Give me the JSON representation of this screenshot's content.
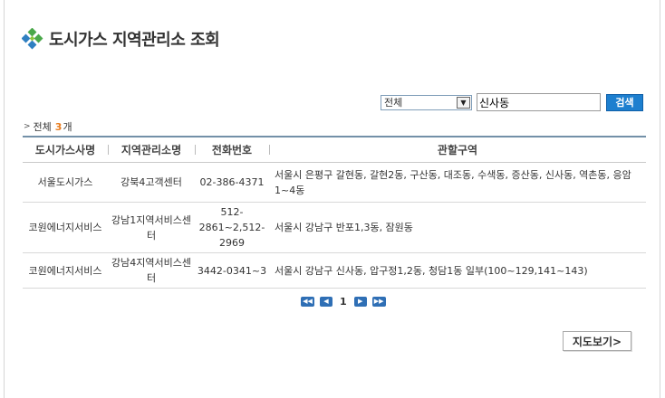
{
  "header": {
    "title": "도시가스 지역관리소 조회",
    "icon": "green-diamond-cluster-icon",
    "accent_color": "#3a9c3a"
  },
  "search": {
    "filter_selected": "전체",
    "keyword_value": "신사동",
    "search_label": "검색"
  },
  "summary": {
    "prefix": "전체",
    "count": "3",
    "suffix": "개",
    "count_color": "#e87c1e"
  },
  "table": {
    "columns": [
      "도시가스사명",
      "지역관리소명",
      "전화번호",
      "관할구역"
    ],
    "rows": [
      {
        "company": "서울도시가스",
        "office": "강북4고객센터",
        "phone": "02-386-4371",
        "area": "서울시 은평구 갈현동, 갈현2동, 구산동, 대조동, 수색동, 증산동, 신사동, 역촌동, 응암1~4동"
      },
      {
        "company": "코원에너지서비스",
        "office": "강남1지역서비스센터",
        "phone": "512-2861~2,512-2969",
        "area": "서울시 강남구 반포1,3동, 잠원동"
      },
      {
        "company": "코원에너지서비스",
        "office": "강남4지역서비스센터",
        "phone": "3442-0341~3",
        "area": "서울시 강남구 신사동, 압구정1,2동, 청담1동 일부(100~129,141~143)"
      }
    ]
  },
  "pagination": {
    "current_page": "1"
  },
  "actions": {
    "map_view_label": "지도보기>"
  },
  "colors": {
    "pager_blue": "#2f6fb5",
    "search_button": "#1d7fcf",
    "table_top_border": "#7390a8"
  }
}
